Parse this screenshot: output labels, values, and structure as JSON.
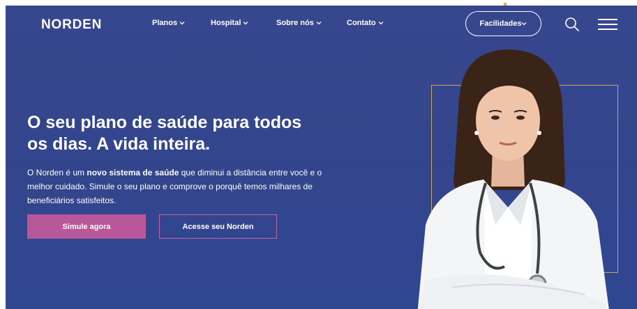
{
  "header": {
    "logo": "NORDEN",
    "nav": [
      {
        "label": "Planos"
      },
      {
        "label": "Hospital"
      },
      {
        "label": "Sobre nós"
      },
      {
        "label": "Contato"
      }
    ],
    "facilidades_label": "Facilidades"
  },
  "hero": {
    "title_line1": "O seu plano de saúde para todos",
    "title_line2": "os dias. A vida inteira.",
    "text_part1": "O Norden é um ",
    "text_bold": "novo sistema de saúde",
    "text_part2": " que diminui a distância entre você e o melhor cuidado. Simule o seu plano e comprove o porquê temos milhares de beneficiários satisfeitos.",
    "primary_button": "Simule agora",
    "secondary_button": "Acesse seu Norden"
  },
  "icons": {
    "search": "search-icon",
    "menu": "hamburger-menu-icon",
    "chevron": "chevron-down-icon"
  },
  "colors": {
    "background": "#37478e",
    "primary_button": "#b8579a",
    "secondary_border": "#c065a6",
    "photo_frame": "#c9a462"
  }
}
